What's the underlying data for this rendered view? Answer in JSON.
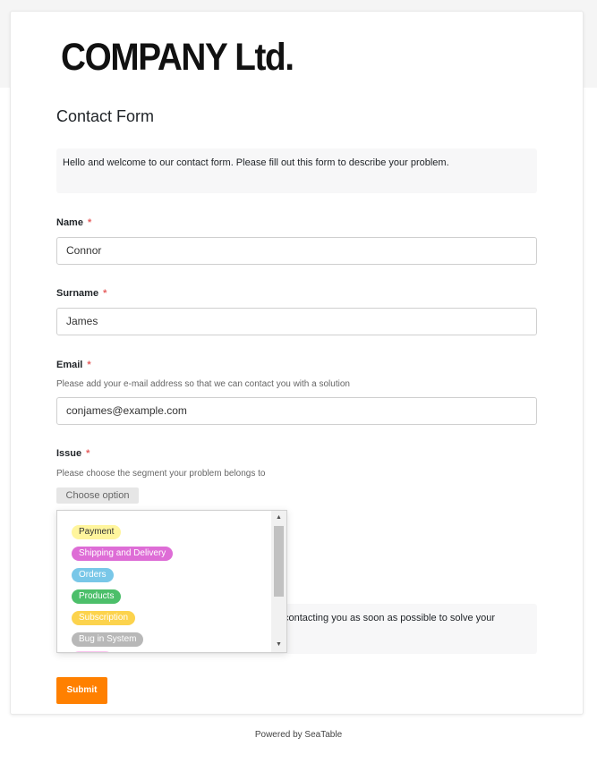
{
  "logo": {
    "text": "COMPANY Ltd."
  },
  "form": {
    "title": "Contact Form",
    "description": "Hello and welcome to our contact form. Please fill out this form to describe your problem.",
    "required_marker": "*",
    "fields": {
      "name": {
        "label": "Name",
        "value": "Connor"
      },
      "surname": {
        "label": "Surname",
        "value": "James"
      },
      "email": {
        "label": "Email",
        "hint": "Please add your e-mail address so that we can contact you with a solution",
        "value": "conjames@example.com"
      },
      "issue": {
        "label": "Issue",
        "hint": "Please choose the segment your problem belongs to",
        "choose_label": "Choose option",
        "options": [
          {
            "label": "Payment",
            "color": "#fff59d",
            "text_color": "#333333"
          },
          {
            "label": "Shipping and Delivery",
            "color": "#de6dd6",
            "text_color": "#ffffff"
          },
          {
            "label": "Orders",
            "color": "#79c7e8",
            "text_color": "#ffffff"
          },
          {
            "label": "Products",
            "color": "#4cbf6a",
            "text_color": "#ffffff"
          },
          {
            "label": "Subscription",
            "color": "#fcd34d",
            "text_color": "#ffffff"
          },
          {
            "label": "Bug in System",
            "color": "#b8b8b8",
            "text_color": "#ffffff"
          },
          {
            "label": "",
            "color": "#f9c2ee",
            "text_color": "#ffffff"
          }
        ]
      }
    },
    "final_text": "contacting you as soon as possible to solve your",
    "submit_label": "Submit"
  },
  "colors": {
    "accent": "#ff8000",
    "required": "#e65e5e"
  },
  "footer": {
    "text": "Powered by SeaTable"
  }
}
